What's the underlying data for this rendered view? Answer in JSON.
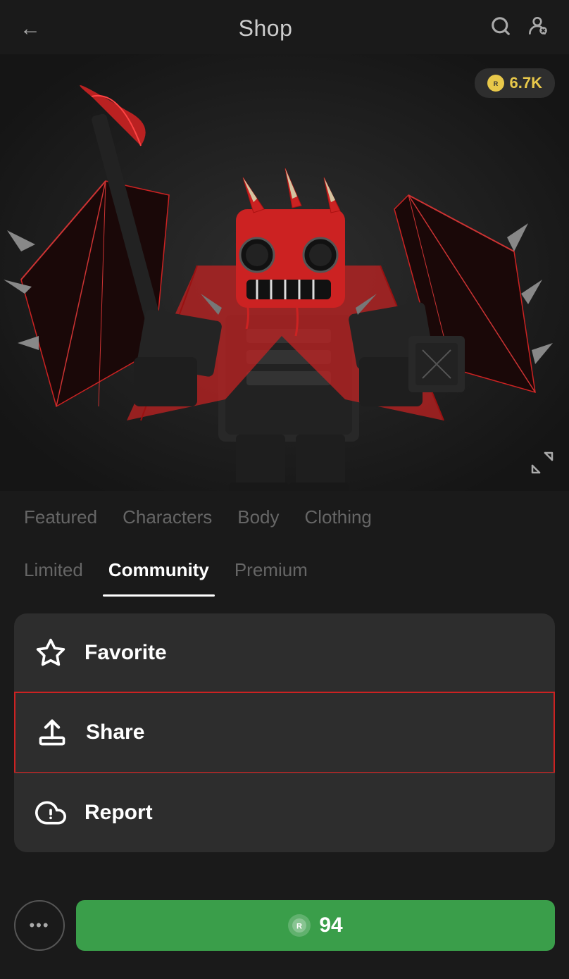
{
  "header": {
    "title": "Shop",
    "back_label": "←",
    "search_icon": "search-icon",
    "settings_icon": "avatar-settings-icon"
  },
  "currency": {
    "amount": "6.7K",
    "icon": "robux-icon"
  },
  "tabs": {
    "row1": [
      {
        "label": "Featured",
        "active": false,
        "id": "featured"
      },
      {
        "label": "Characters",
        "active": false,
        "id": "characters"
      },
      {
        "label": "Body",
        "active": false,
        "id": "body"
      },
      {
        "label": "Clothing",
        "active": false,
        "id": "clothing"
      }
    ],
    "row2": [
      {
        "label": "Limited",
        "active": false,
        "id": "limited"
      },
      {
        "label": "Community",
        "active": true,
        "id": "community"
      },
      {
        "label": "Premium",
        "active": false,
        "id": "premium"
      }
    ]
  },
  "actions": [
    {
      "id": "favorite",
      "label": "Favorite",
      "icon": "star-icon",
      "highlighted": false
    },
    {
      "id": "share",
      "label": "Share",
      "icon": "share-icon",
      "highlighted": true
    },
    {
      "id": "report",
      "label": "Report",
      "icon": "report-icon",
      "highlighted": false
    }
  ],
  "bottom_bar": {
    "more_label": "•••",
    "buy_label": "94",
    "buy_icon": "robux-buy-icon"
  }
}
